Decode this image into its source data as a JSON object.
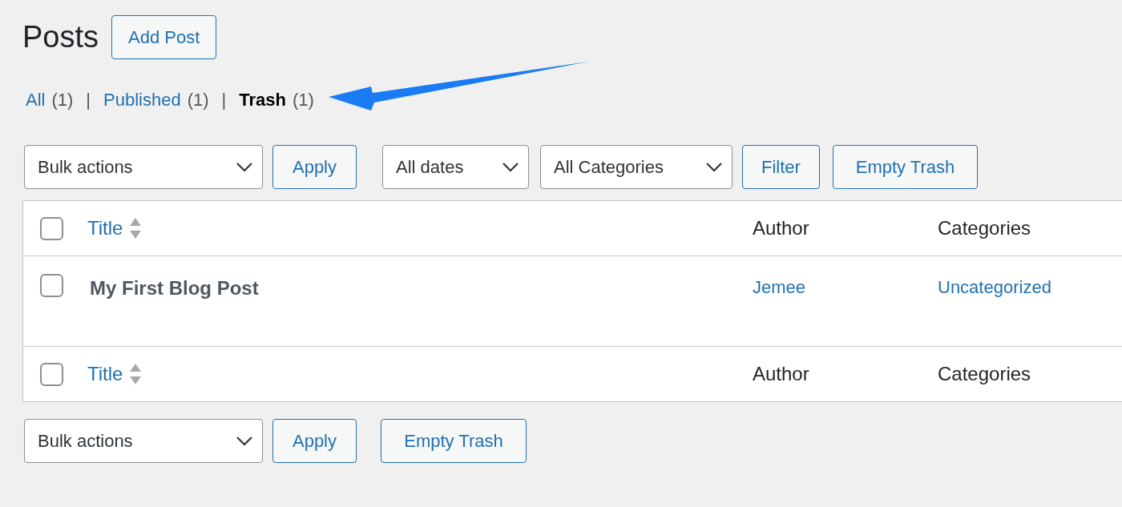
{
  "page_title": "Posts",
  "add_button": "Add Post",
  "views": [
    {
      "label": "All",
      "count": "(1)",
      "selected": false
    },
    {
      "separator": "|",
      "label": "Published",
      "count": "(1)",
      "selected": false
    },
    {
      "separator": "|",
      "label": "Trash",
      "count": "(1)",
      "selected": true
    }
  ],
  "top_toolbar": {
    "bulk_actions": "Bulk actions",
    "apply": "Apply",
    "dates": "All dates",
    "categories": "All Categories",
    "filter": "Filter",
    "empty_trash": "Empty Trash"
  },
  "table": {
    "header": {
      "checked": false,
      "columns": [
        "Title",
        "Author",
        "Categories"
      ]
    },
    "rows": [
      {
        "checked": false,
        "title": "My First Blog Post",
        "author": "Jemee",
        "category": "Uncategorized"
      }
    ],
    "footer": {
      "checked": false,
      "columns": [
        "Title",
        "Author",
        "Categories"
      ]
    }
  },
  "bottom_toolbar": {
    "bulk_actions": "Bulk actions",
    "apply": "Apply",
    "empty_trash": "Empty Trash"
  }
}
